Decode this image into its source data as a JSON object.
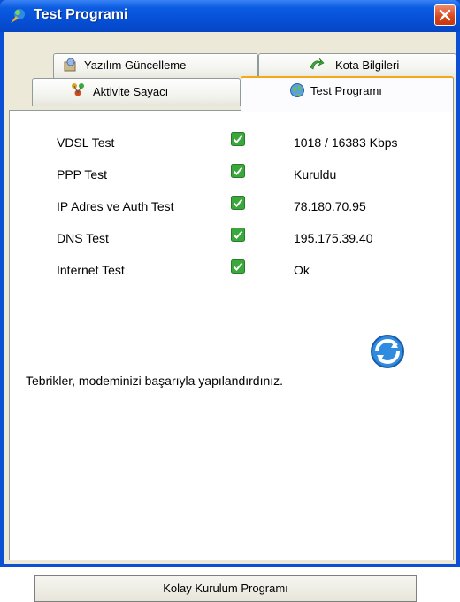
{
  "window": {
    "title": "Test Programi"
  },
  "tabs_row1": [
    {
      "label": "Yazılım Güncelleme",
      "icon": "software-update-icon"
    },
    {
      "label": "Kota Bilgileri",
      "icon": "quota-arrow-icon"
    }
  ],
  "tabs_row2": [
    {
      "label": "Aktivite Sayacı",
      "icon": "activity-counter-icon"
    },
    {
      "label": "Test Programı",
      "icon": "globe-icon",
      "active": true
    }
  ],
  "tests": [
    {
      "label": "VDSL Test",
      "value": "1018 / 16383 Kbps",
      "status": "check"
    },
    {
      "label": "PPP Test",
      "value": "Kuruldu",
      "status": "check"
    },
    {
      "label": "IP Adres ve Auth Test",
      "value": "78.180.70.95",
      "status": "check"
    },
    {
      "label": "DNS Test",
      "value": "195.175.39.40",
      "status": "check"
    },
    {
      "label": "Internet Test",
      "value": "Ok",
      "status": "check"
    }
  ],
  "message": "Tebrikler, modeminizi başarıyla yapılandırdınız.",
  "button": {
    "label": "Kolay Kurulum Programı"
  },
  "colors": {
    "titlebar": "#0650d8",
    "accent_tab": "#f5a81a",
    "check_green": "#3aa83a"
  }
}
